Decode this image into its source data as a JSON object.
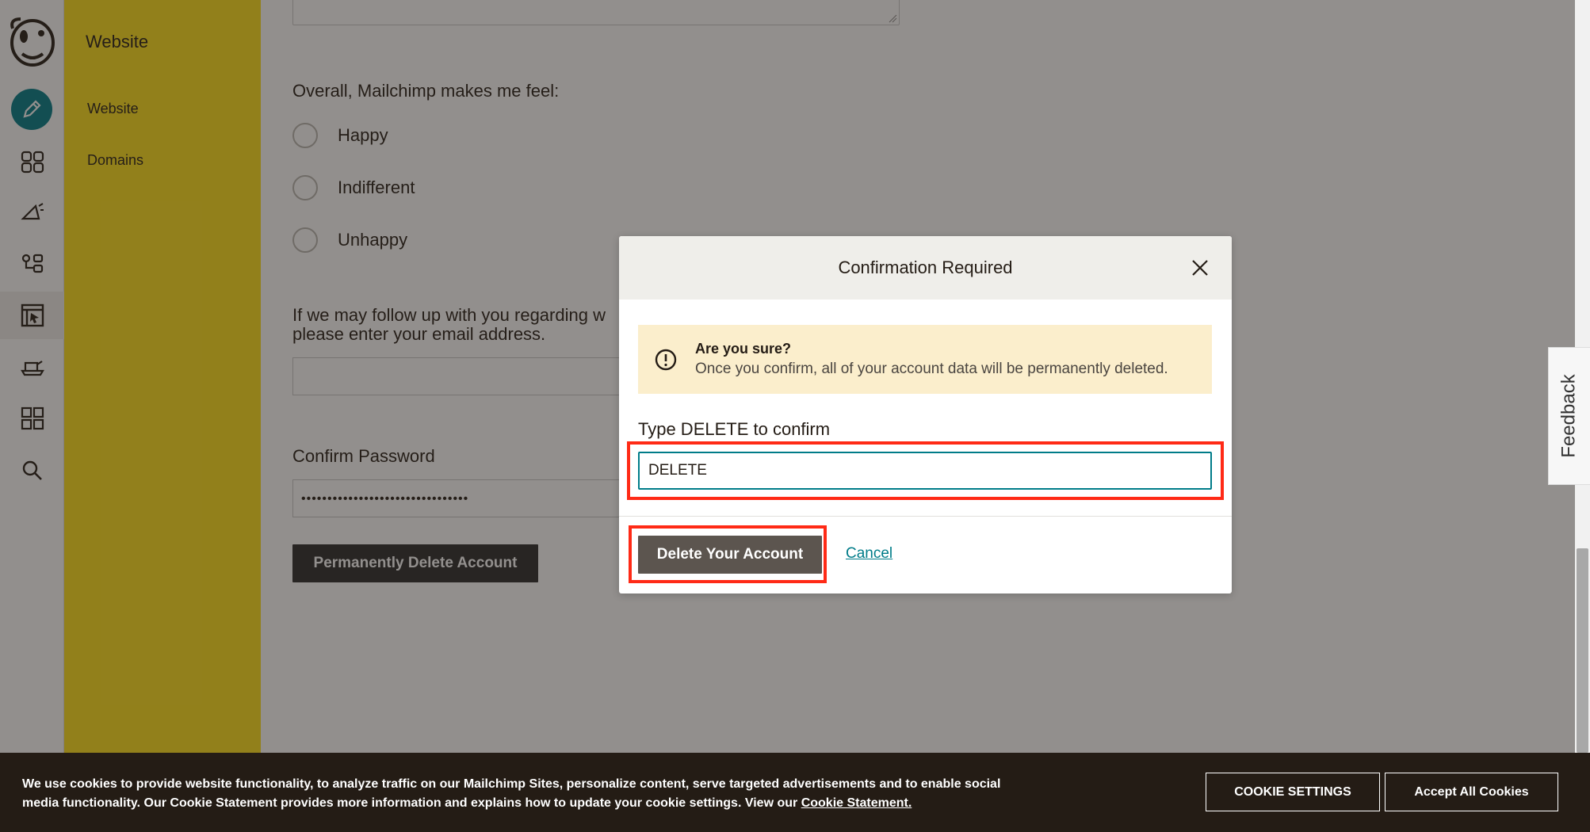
{
  "subnav": {
    "title": "Website",
    "items": [
      {
        "label": "Website"
      },
      {
        "label": "Domains"
      }
    ]
  },
  "rail": {
    "icons": [
      "mailchimp-logo",
      "pencil-icon",
      "audience-icon",
      "campaign-icon",
      "automation-icon",
      "website-icon",
      "integrations-icon",
      "grid-icon",
      "search-icon"
    ]
  },
  "form": {
    "feeling_question": "Overall, Mailchimp makes me feel:",
    "feeling_options": [
      "Happy",
      "Indifferent",
      "Unhappy"
    ],
    "followup_line1": "If we may follow up with you regarding w",
    "followup_line2": "please enter your email address.",
    "email_value": "",
    "password_label": "Confirm Password",
    "password_value": "••••••••••••••••••••••••••••••••",
    "delete_button": "Permanently Delete Account"
  },
  "modal": {
    "title": "Confirmation Required",
    "alert_title": "Are you sure?",
    "alert_body": "Once you confirm, all of your account data will be permanently deleted.",
    "type_label": "Type DELETE to confirm",
    "input_value": "DELETE",
    "delete_button": "Delete Your Account",
    "cancel_link": "Cancel"
  },
  "feedback": {
    "label": "Feedback"
  },
  "cookie": {
    "text": "We use cookies to provide website functionality, to analyze traffic on our Mailchimp Sites, personalize content, serve targeted advertisements and to enable social media functionality. Our Cookie Statement provides more information and explains how to update your cookie settings. View our ",
    "link": "Cookie Statement.",
    "settings_button": "COOKIE SETTINGS",
    "accept_button": "Accept All Cookies"
  },
  "colors": {
    "brand_yellow": "#ffe01b",
    "accent_teal": "#007c89",
    "highlight_red": "#ff2a16",
    "cookie_bg": "#241c15"
  }
}
